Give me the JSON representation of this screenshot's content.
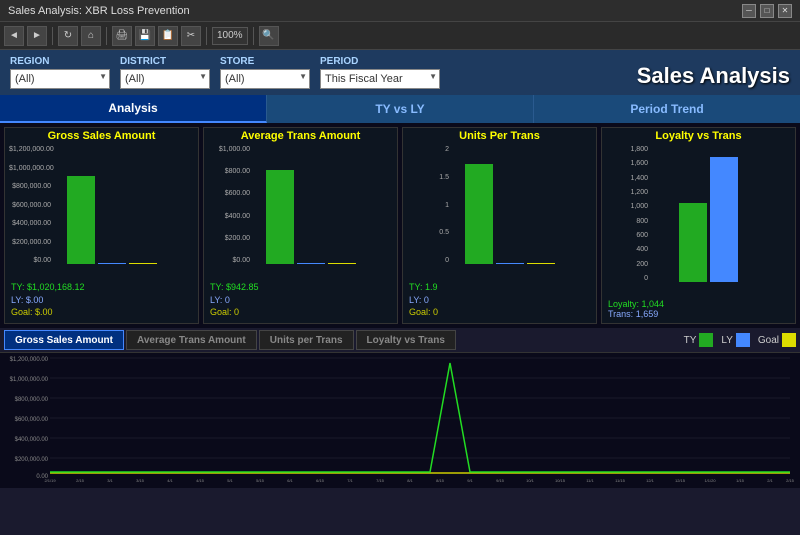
{
  "titleBar": {
    "title": "Sales Analysis: XBR Loss Prevention",
    "minimize": "─",
    "maximize": "□",
    "close": "✕"
  },
  "toolbar": {
    "zoom": "100%"
  },
  "filters": {
    "regionLabel": "REGION",
    "regionValue": "(All)",
    "districtLabel": "DISTRICT",
    "districtValue": "(All)",
    "storeLabel": "STORE",
    "storeValue": "(All)",
    "periodLabel": "PERIOD",
    "periodValue": "This Fiscal Year"
  },
  "pageTitle": "Sales Analysis",
  "tabs": [
    {
      "label": "Analysis",
      "active": true
    },
    {
      "label": "TY vs LY",
      "active": false
    },
    {
      "label": "Period Trend",
      "active": false
    }
  ],
  "charts": [
    {
      "title": "Gross Sales Amount",
      "yAxis": [
        "$1,200,000.00",
        "$1,000,000.00",
        "$800,000.00",
        "$600,000.00",
        "$400,000.00",
        "$200,000.00",
        "$0.00"
      ],
      "stats": {
        "ty": "TY: $1,020,168.12",
        "ly": "LY: $.00",
        "goal": "Goal: $.00"
      },
      "barHeight": 75,
      "hasGreen": true,
      "hasBlue": false,
      "hasYellow": false
    },
    {
      "title": "Average Trans Amount",
      "yAxis": [
        "$1,000.00",
        "$800.00",
        "$600.00",
        "$400.00",
        "$200.00",
        "$0.00"
      ],
      "stats": {
        "ty": "TY: $942.85",
        "ly": "LY: 0",
        "goal": "Goal: 0"
      },
      "barHeight": 80,
      "hasGreen": true,
      "hasBlue": false,
      "hasYellow": false
    },
    {
      "title": "Units Per Trans",
      "yAxis": [
        "2",
        "1.5",
        "1",
        "0.5",
        "0"
      ],
      "stats": {
        "ty": "TY: 1.9",
        "ly": "LY: 0",
        "goal": "Goal: 0"
      },
      "barHeight": 85,
      "hasGreen": true,
      "hasBlue": false,
      "hasYellow": false
    },
    {
      "title": "Loyalty vs Trans",
      "yAxis": [
        "1,800",
        "1,600",
        "1,400",
        "1,200",
        "1,000",
        "800",
        "600",
        "400",
        "200",
        "0"
      ],
      "loyalty": "1,044",
      "trans": "1,659",
      "hasGreen": true,
      "hasBlue": true
    }
  ],
  "bottomTabs": [
    {
      "label": "Gross Sales Amount",
      "active": true
    },
    {
      "label": "Average Trans Amount",
      "active": false
    },
    {
      "label": "Units per Trans",
      "active": false
    },
    {
      "label": "Loyalty vs Trans",
      "active": false
    }
  ],
  "legend": [
    {
      "label": "TY",
      "color": "green"
    },
    {
      "label": "LY",
      "color": "blue"
    },
    {
      "label": "Goal",
      "color": "yellow"
    }
  ],
  "trendYAxis": [
    "$1,200,000.00",
    "$1,000,000.00",
    "$800,000.00",
    "$600,000.00",
    "$400,000.00",
    "$200,000.00",
    "0.00"
  ]
}
